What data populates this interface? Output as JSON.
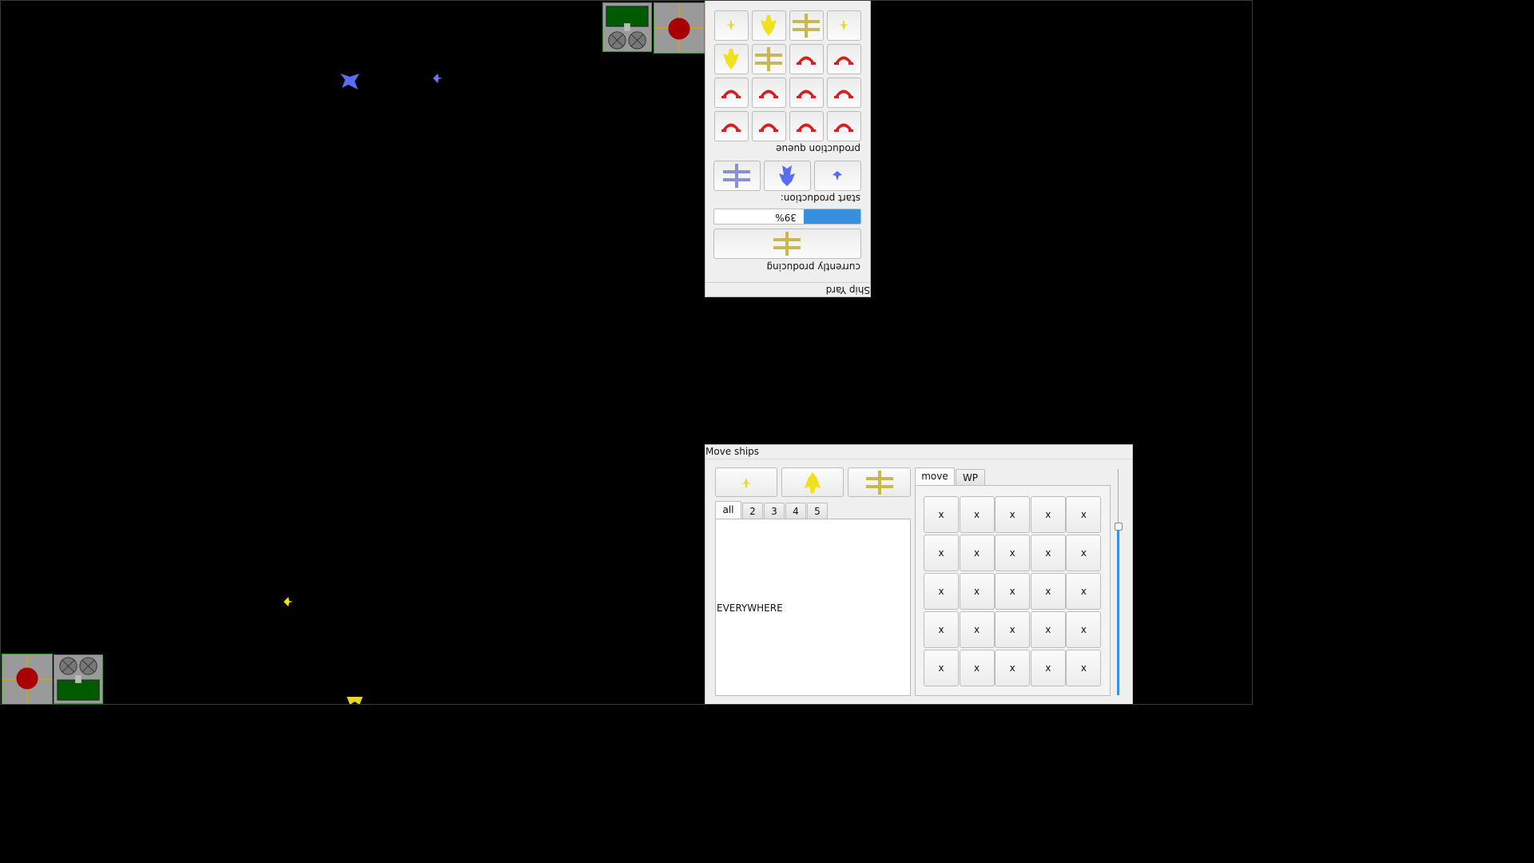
{
  "shipyard": {
    "title": "Ship Yard",
    "currently_producing_label": "currently producing",
    "current_item_icon": "yellow-cross-ship-icon",
    "progress_label": "39%",
    "progress_value": 0.39,
    "start_production_label": "start production:",
    "start_buttons": [
      "blue-cross-ship-icon",
      "blue-heavy-ship-icon",
      "blue-small-ship-icon"
    ],
    "production_queue_label": "production queue",
    "queue_items": [
      "red-magnet-icon",
      "red-magnet-icon",
      "red-magnet-icon",
      "red-magnet-icon",
      "red-magnet-icon",
      "red-magnet-icon",
      "red-magnet-icon",
      "red-magnet-icon",
      "red-magnet-icon",
      "red-magnet-icon",
      "yellow-cross-ship-icon",
      "yellow-heavy-ship-icon",
      "yellow-small-ship-icon",
      "yellow-cross-ship-icon",
      "yellow-heavy-ship-icon",
      "yellow-small-ship-icon"
    ]
  },
  "moveships": {
    "title": "Move ships",
    "ship_buttons": [
      "yellow-small-ship-icon",
      "yellow-heavy-ship-icon",
      "yellow-cross-ship-icon"
    ],
    "group_tabs": [
      "all",
      "2",
      "3",
      "4",
      "5"
    ],
    "list_item": "EVERYWHERE",
    "mode_tabs": [
      "move",
      "WP"
    ],
    "grid_cells": [
      [
        "x",
        "x",
        "x",
        "x",
        "x"
      ],
      [
        "x",
        "x",
        "x",
        "x",
        "x"
      ],
      [
        "x",
        "x",
        "x",
        "x",
        "x"
      ],
      [
        "x",
        "x",
        "x",
        "x",
        "x"
      ],
      [
        "x",
        "x",
        "x",
        "x",
        "x"
      ]
    ]
  },
  "colors": {
    "background": "#000000",
    "accent": "#3a8fdc",
    "red_player": "#cc1111",
    "yellow_player": "#f0e020",
    "blue_player": "#5a6cf0"
  }
}
